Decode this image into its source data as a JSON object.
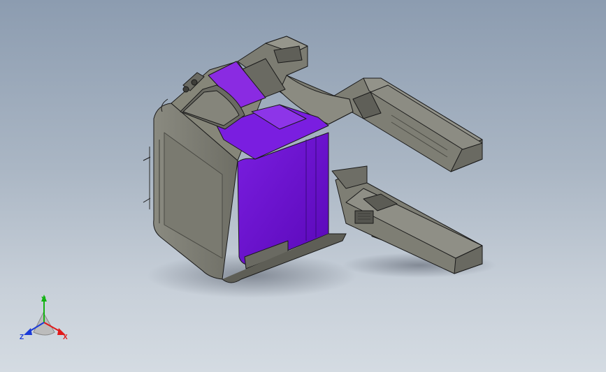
{
  "viewport": {
    "background_top": "#8c9cb0",
    "background_bottom": "#d4dbe2"
  },
  "model": {
    "body_color": "#7c7c72",
    "body_shadow": "#5e5e56",
    "highlight_color": "#6a0dcc",
    "highlight_light": "#8a2be2",
    "edge_color": "#1a1a1a"
  },
  "triad": {
    "x_label": "X",
    "y_label": "Y",
    "z_label": "Z",
    "x_color": "#e11a1a",
    "y_color": "#13b313",
    "z_color": "#1a3ad8"
  }
}
